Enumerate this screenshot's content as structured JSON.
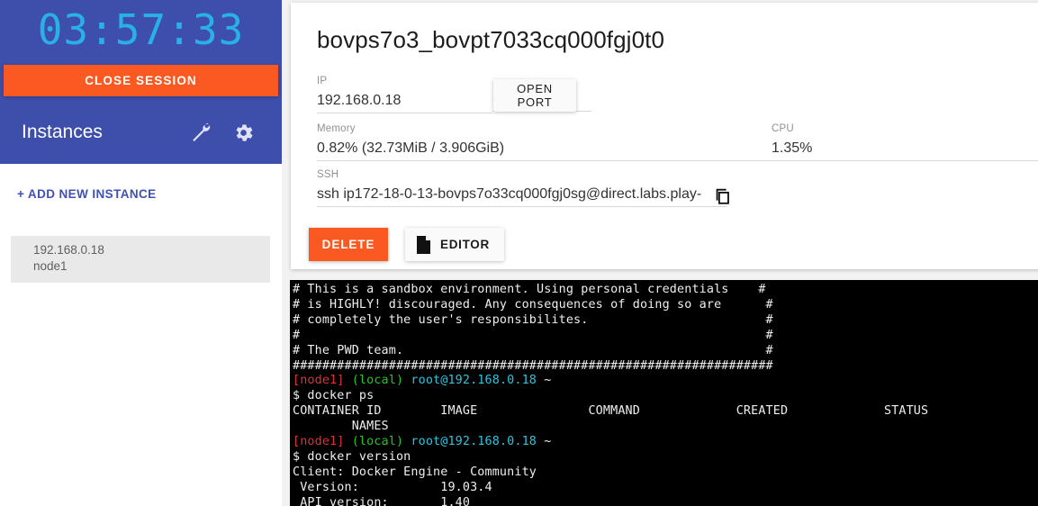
{
  "sidebar": {
    "timer": "03:57:33",
    "close_session_label": "CLOSE SESSION",
    "instances_title": "Instances",
    "icons": [
      {
        "name": "wrench-icon",
        "label": "settings-wrench"
      },
      {
        "name": "gear-icon",
        "label": "settings-gear"
      }
    ],
    "add_instance_label": "+ ADD NEW INSTANCE",
    "instances": [
      {
        "ip": "192.168.0.18",
        "name": "node1",
        "selected": true
      }
    ],
    "colors": {
      "background": "#3d4eab",
      "timer_text": "#29b0e8",
      "close_session": "#fa5a22",
      "link": "#3f51b5",
      "selected_item": "#e9e9e9"
    }
  },
  "instance": {
    "title": "bovps7o3_bovpt7033cq000fgj0t0",
    "fields": {
      "ip": {
        "label": "IP",
        "value": "192.168.0.18"
      },
      "port": {
        "label": "",
        "value": "",
        "placeholder": "-"
      },
      "memory": {
        "label": "Memory",
        "value": "0.82% (32.73MiB / 3.906GiB)"
      },
      "cpu": {
        "label": "CPU",
        "value": "1.35%"
      },
      "ssh": {
        "label": "SSH",
        "value": "ssh ip172-18-0-13-bovps7o33cq000fgj0sg@direct.labs.play-"
      }
    },
    "buttons": {
      "open_port": "OPEN PORT",
      "delete": "DELETE",
      "editor": "EDITOR",
      "copy_icon": "copy-icon",
      "editor_icon": "document-icon"
    },
    "colors": {
      "delete": "#fa5a22",
      "card": "#ffffff",
      "label": "#919191"
    }
  },
  "terminal": {
    "colors": {
      "background": "#000000",
      "text": "#eeeeee",
      "host": "#dd3333",
      "scope": "#1ecb1e",
      "user": "#2fc3dd"
    },
    "lines": [
      {
        "segments": [
          {
            "text": "# This is a sandbox environment. Using personal credentials    #",
            "color": "c-white"
          }
        ]
      },
      {
        "segments": [
          {
            "text": "# is HIGHLY! discouraged. Any consequences of doing so are      #",
            "color": "c-white"
          }
        ]
      },
      {
        "segments": [
          {
            "text": "# completely the user's responsibilites.                        #",
            "color": "c-white"
          }
        ]
      },
      {
        "segments": [
          {
            "text": "#                                                               #",
            "color": "c-white"
          }
        ]
      },
      {
        "segments": [
          {
            "text": "# The PWD team.                                                 #",
            "color": "c-white"
          }
        ]
      },
      {
        "segments": [
          {
            "text": "#################################################################",
            "color": "c-white"
          }
        ]
      },
      {
        "segments": [
          {
            "text": "[node1]",
            "color": "c-red"
          },
          {
            "text": " ",
            "color": "c-white"
          },
          {
            "text": "(local)",
            "color": "c-green"
          },
          {
            "text": " ",
            "color": "c-white"
          },
          {
            "text": "root@192.168.0.18",
            "color": "c-cyan"
          },
          {
            "text": " ~",
            "color": "c-white"
          }
        ]
      },
      {
        "segments": [
          {
            "text": "$ docker ps",
            "color": "c-white"
          }
        ]
      },
      {
        "segments": [
          {
            "text": "CONTAINER ID        IMAGE               COMMAND             CREATED             STATUS",
            "color": "c-white"
          }
        ]
      },
      {
        "segments": [
          {
            "text": "        NAMES",
            "color": "c-white"
          }
        ]
      },
      {
        "segments": [
          {
            "text": "[node1]",
            "color": "c-red"
          },
          {
            "text": " ",
            "color": "c-white"
          },
          {
            "text": "(local)",
            "color": "c-green"
          },
          {
            "text": " ",
            "color": "c-white"
          },
          {
            "text": "root@192.168.0.18",
            "color": "c-cyan"
          },
          {
            "text": " ~",
            "color": "c-white"
          }
        ]
      },
      {
        "segments": [
          {
            "text": "$ docker version",
            "color": "c-white"
          }
        ]
      },
      {
        "segments": [
          {
            "text": "Client: Docker Engine - Community",
            "color": "c-white"
          }
        ]
      },
      {
        "segments": [
          {
            "text": " Version:           19.03.4",
            "color": "c-white"
          }
        ]
      },
      {
        "segments": [
          {
            "text": " API version:       1.40",
            "color": "c-white"
          }
        ]
      }
    ]
  }
}
